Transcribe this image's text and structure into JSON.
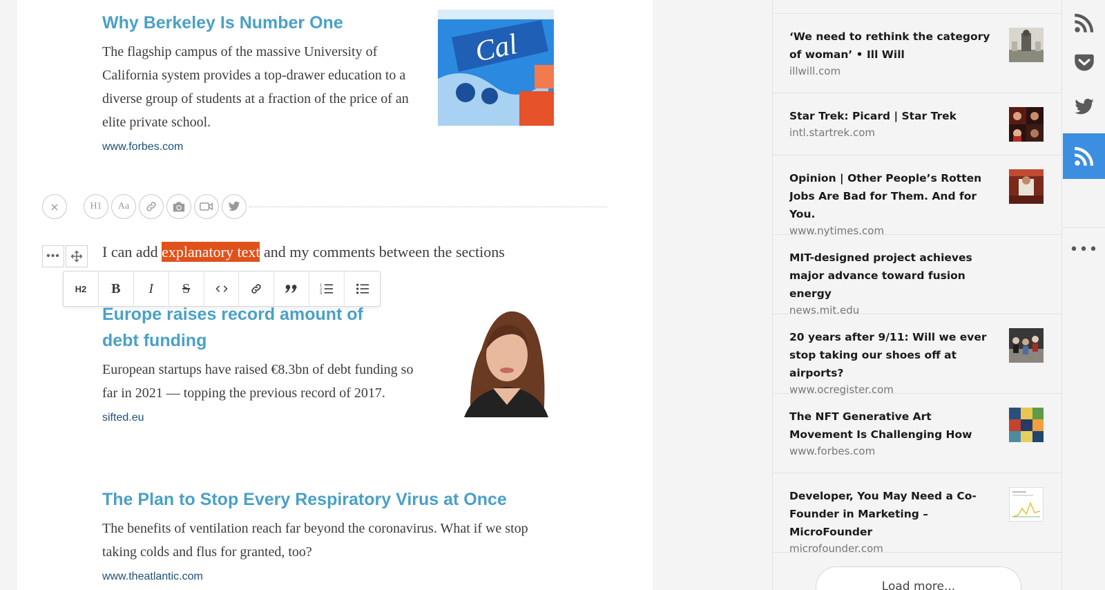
{
  "articles": [
    {
      "title": "Why Berkeley Is Number One",
      "description": "The flagship campus of the massive University of California system provides a top-drawer education to a diverse group of students at a fraction of the price of an elite private school.",
      "source": "www.forbes.com"
    },
    {
      "title": "Europe raises record amount of debt funding",
      "description": "European startups have raised €8.3bn of debt funding so far in 2021 — topping the previous record of 2017.",
      "source": "sifted.eu"
    },
    {
      "title": "The Plan to Stop Every Respiratory Virus at Once",
      "description": "The benefits of ventilation reach far beyond the coronavirus. What if we stop taking colds and flus for granted, too?",
      "source": "www.theatlantic.com"
    }
  ],
  "insert_toolbar": {
    "close": "×",
    "h1": "H1",
    "text": "Aa"
  },
  "paragraph": {
    "before": "I can add ",
    "highlight": "explanatory text",
    "after": " and my comments between the sections"
  },
  "format_toolbar": {
    "h2": "H2",
    "bold": "B",
    "italic": "I",
    "strike": "S"
  },
  "highlight_color": "#e0521b",
  "accent_color": "#3c8ee0",
  "sidebar": {
    "items": [
      {
        "title": "‘We need to rethink the category of woman’ • Ill Will",
        "domain": "illwill.com"
      },
      {
        "title": "Star Trek: Picard | Star Trek",
        "domain": "intl.startrek.com"
      },
      {
        "title": "Opinion | Other People’s Rotten Jobs Are Bad for Them. And for You.",
        "domain": "www.nytimes.com"
      },
      {
        "title": "MIT-designed project achieves major advance toward fusion energy",
        "domain": "news.mit.edu"
      },
      {
        "title": "20 years after 9/11: Will we ever stop taking our shoes off at airports?",
        "domain": "www.ocregister.com"
      },
      {
        "title": "The NFT Generative Art Movement Is Challenging How We Think About V",
        "domain": "www.forbes.com"
      },
      {
        "title": "Developer, You May Need a Co-Founder in Marketing – MicroFounder",
        "domain": "microfounder.com"
      }
    ],
    "load_more": "Load more..."
  },
  "rail": {
    "icons": [
      "rss-icon",
      "pocket-icon",
      "twitter-icon",
      "rss-icon",
      "more-icon"
    ],
    "active_index": 3
  }
}
